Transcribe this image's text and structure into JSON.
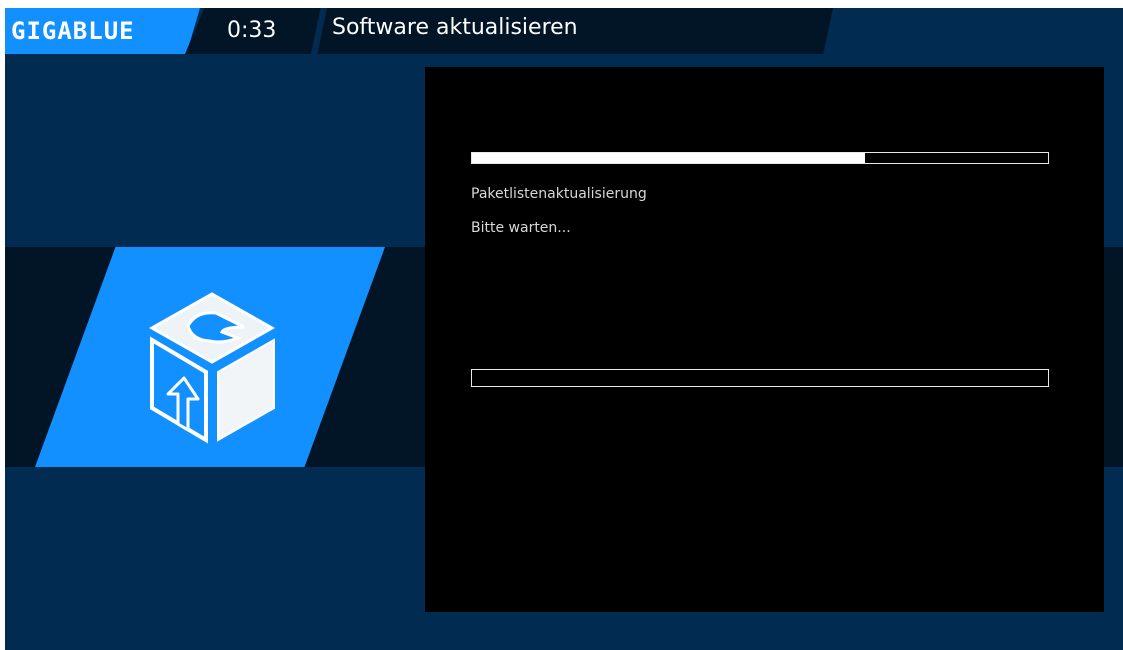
{
  "header": {
    "logo_text": "GIGABLUE",
    "clock": "0:33",
    "title": "Software aktualisieren"
  },
  "icon": {
    "name": "software-update-package-icon"
  },
  "panel": {
    "progress_main": 0.682,
    "progress_secondary": 0.0,
    "status_text": "Paketlistenaktualisierung",
    "wait_text": "Bitte warten..."
  },
  "colors": {
    "background": "#022b52",
    "accent": "#1290ff",
    "dark_band": "#011527",
    "panel": "#000000"
  }
}
